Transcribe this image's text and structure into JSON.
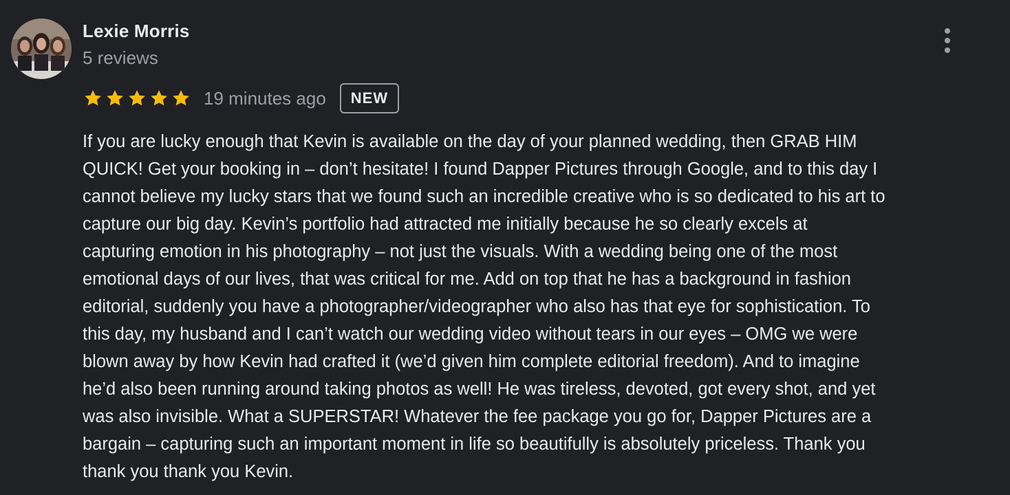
{
  "review": {
    "author_name": "Lexie Morris",
    "review_count": "5 reviews",
    "rating": 5,
    "rating_max": 5,
    "time_ago": "19 minutes ago",
    "badge": "NEW",
    "text": "If you are lucky enough that Kevin is available on the day of your planned wedding, then GRAB HIM\nQUICK! Get your booking in – don’t hesitate!  I found Dapper Pictures through Google, and to this day I\ncannot believe my lucky stars that we found such an incredible creative who is so dedicated to his art to\ncapture our big day.  Kevin’s portfolio had attracted me initially because he so clearly excels at\ncapturing emotion in his photography – not just the visuals.  With a wedding being one of the most\nemotional days of our lives, that was critical for me.  Add on top that he has a background in fashion\neditorial, suddenly you have a photographer/videographer who also has that eye for sophistication.  To\nthis day, my husband and I can’t watch our wedding video without tears in our eyes – OMG we were\nblown away by how Kevin had crafted it (we’d given him complete editorial freedom).  And to imagine\nhe’d also been running around taking photos as well!  He was tireless, devoted, got every shot, and yet\nwas also invisible.  What a SUPERSTAR!  Whatever the fee package you go for, Dapper Pictures are a\nbargain – capturing such an important moment in life so beautifully is absolutely priceless. Thank you\nthank you thank you Kevin."
  },
  "icons": {
    "star": "star-icon",
    "more": "more-vert-icon",
    "avatar": "profile-photo"
  },
  "colors": {
    "background": "#202124",
    "text_primary": "#e8eaed",
    "text_secondary": "#9aa0a6",
    "star": "#fbbc04"
  }
}
